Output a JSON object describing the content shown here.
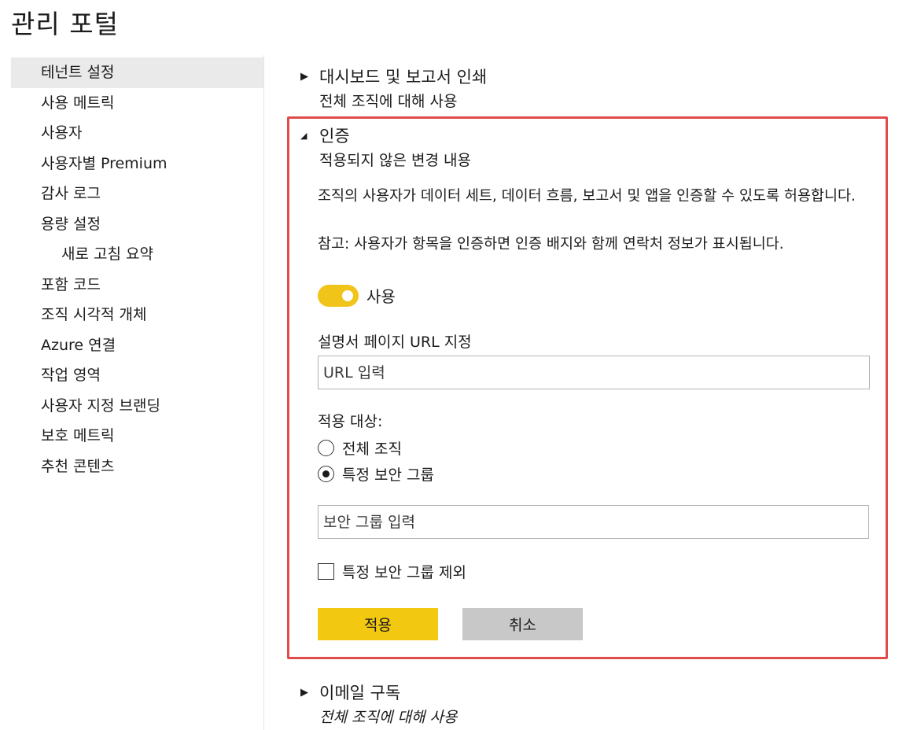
{
  "page": {
    "title": "관리 포털"
  },
  "sidebar": {
    "items": [
      {
        "label": "테넌트 설정",
        "selected": true,
        "sub": false
      },
      {
        "label": "사용 메트릭",
        "selected": false,
        "sub": false
      },
      {
        "label": "사용자",
        "selected": false,
        "sub": false
      },
      {
        "label": "사용자별 Premium",
        "selected": false,
        "sub": false
      },
      {
        "label": "감사 로그",
        "selected": false,
        "sub": false
      },
      {
        "label": "용량 설정",
        "selected": false,
        "sub": false
      },
      {
        "label": "새로 고침 요약",
        "selected": false,
        "sub": true
      },
      {
        "label": "포함 코드",
        "selected": false,
        "sub": false
      },
      {
        "label": "조직 시각적 개체",
        "selected": false,
        "sub": false
      },
      {
        "label": "Azure 연결",
        "selected": false,
        "sub": false
      },
      {
        "label": "작업 영역",
        "selected": false,
        "sub": false
      },
      {
        "label": "사용자 지정 브랜딩",
        "selected": false,
        "sub": false
      },
      {
        "label": "보호 메트릭",
        "selected": false,
        "sub": false
      },
      {
        "label": "추천 콘텐츠",
        "selected": false,
        "sub": false
      }
    ]
  },
  "sections": {
    "print": {
      "title": "대시보드 및 보고서 인쇄",
      "status": "전체 조직에 대해 사용",
      "icon": "caret-right-icon"
    },
    "certification": {
      "title": "인증",
      "status": "적용되지 않은 변경 내용",
      "icon": "caret-down-icon",
      "description": "조직의 사용자가 데이터 세트, 데이터 흐름, 보고서 및 앱을 인증할 수 있도록 허용합니다.",
      "note": "참고: 사용자가 항목을 인증하면 인증 배지와 함께 연락처 정보가 표시됩니다.",
      "toggle": {
        "label": "사용",
        "on": true,
        "color": "#f0c419"
      },
      "url_label": "설명서 페이지 URL 지정",
      "url_placeholder": "URL 입력",
      "apply_to_label": "적용 대상:",
      "radio_options": [
        {
          "label": "전체 조직",
          "checked": false
        },
        {
          "label": "특정 보안 그룹",
          "checked": true
        }
      ],
      "group_placeholder": "보안 그룹 입력",
      "exclude_label": "특정 보안 그룹 제외",
      "exclude_checked": false,
      "apply_button": "적용",
      "cancel_button": "취소",
      "highlight_color": "#e04b4b"
    },
    "email": {
      "title": "이메일 구독",
      "status": "전체 조직에 대해 사용",
      "icon": "caret-right-icon"
    }
  }
}
